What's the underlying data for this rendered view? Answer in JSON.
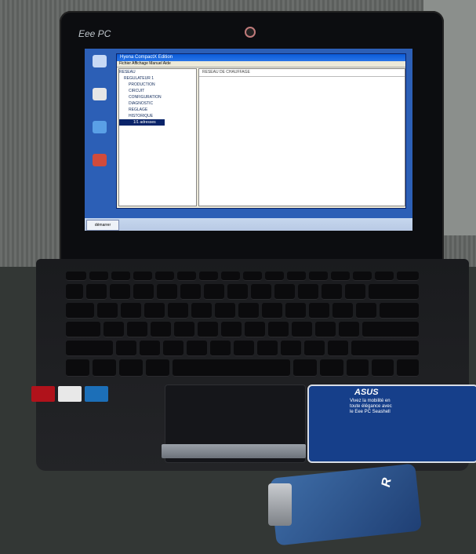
{
  "laptop": {
    "brand": "Eee PC"
  },
  "screen": {
    "window_title": "Hyena CompactX Edition",
    "menu": "Fichier Affichage Manuel Aide",
    "panel_header": "RESEAU DE CHAUFFAGE",
    "tree_items": [
      "RESEAU",
      "REGULATEUR 1",
      "PRODUCTION",
      "CIRCUIT",
      "CONFIGURATION",
      "DIAGNOSTIC",
      "REGLAGE",
      "HISTORIQUE",
      "1/1 adresses"
    ],
    "start_label": "démarrer"
  },
  "stickers": {
    "asus_logo": "ASUS",
    "asus_slogan": "Vivez la mobilité en toute élégance avec le Eee PC Seashell"
  },
  "adapter": {
    "label": "R"
  }
}
